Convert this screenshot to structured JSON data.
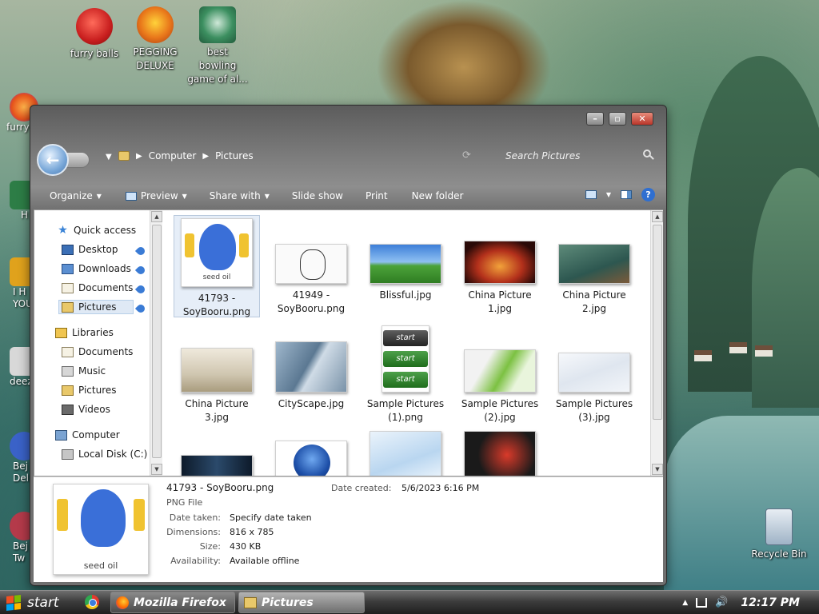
{
  "desktop": {
    "icons": [
      {
        "label": "furry balls"
      },
      {
        "label": "PEGGING DELUXE"
      },
      {
        "label": "best bowling game of al..."
      },
      {
        "label": "Recycle Bin"
      }
    ],
    "edge_labels": [
      "furry",
      "H",
      "I H YOU",
      "deez",
      "Bej Del",
      "Bej Tw"
    ]
  },
  "window": {
    "breadcrumb": [
      "Computer",
      "Pictures"
    ],
    "search_placeholder": "Search Pictures",
    "toolbar": {
      "organize": "Organize",
      "preview": "Preview",
      "share_with": "Share with",
      "slide_show": "Slide show",
      "print": "Print",
      "new_folder": "New folder"
    },
    "nav": {
      "quick_access": "Quick access",
      "qa_items": [
        "Desktop",
        "Downloads",
        "Documents",
        "Pictures"
      ],
      "libraries": "Libraries",
      "lib_items": [
        "Documents",
        "Music",
        "Pictures",
        "Videos"
      ],
      "computer": "Computer",
      "local_disk": "Local Disk (C:)"
    },
    "files": [
      {
        "name": "41793 - SoyBooru.png"
      },
      {
        "name": "41949 - SoyBooru.png"
      },
      {
        "name": "Blissful.jpg"
      },
      {
        "name": "China Picture 1.jpg"
      },
      {
        "name": "China Picture 2.jpg"
      },
      {
        "name": "China Picture 3.jpg"
      },
      {
        "name": "CityScape.jpg"
      },
      {
        "name": "Sample Pictures (1).png"
      },
      {
        "name": "Sample Pictures (2).jpg"
      },
      {
        "name": "Sample Pictures (3).jpg"
      }
    ],
    "start_thumb_text": "start",
    "thumb_caption": "seed oil",
    "details": {
      "filename": "41793 - SoyBooru.png",
      "type": "PNG File",
      "date_created_label": "Date created:",
      "date_created_value": "5/6/2023 6:16 PM",
      "rows": [
        {
          "label": "Date taken:",
          "value": "Specify date taken"
        },
        {
          "label": "Dimensions:",
          "value": "816 x 785"
        },
        {
          "label": "Size:",
          "value": "430 KB"
        },
        {
          "label": "Availability:",
          "value": "Available offline"
        }
      ]
    }
  },
  "taskbar": {
    "start_label": "start",
    "firefox_label": "Mozilla Firefox",
    "pictures_label": "Pictures",
    "clock": "12:17 PM"
  },
  "colors": {
    "accent": "#2f6fd1",
    "selection": "#e6eef8",
    "taskbar_dark": "#1f1f1f"
  }
}
